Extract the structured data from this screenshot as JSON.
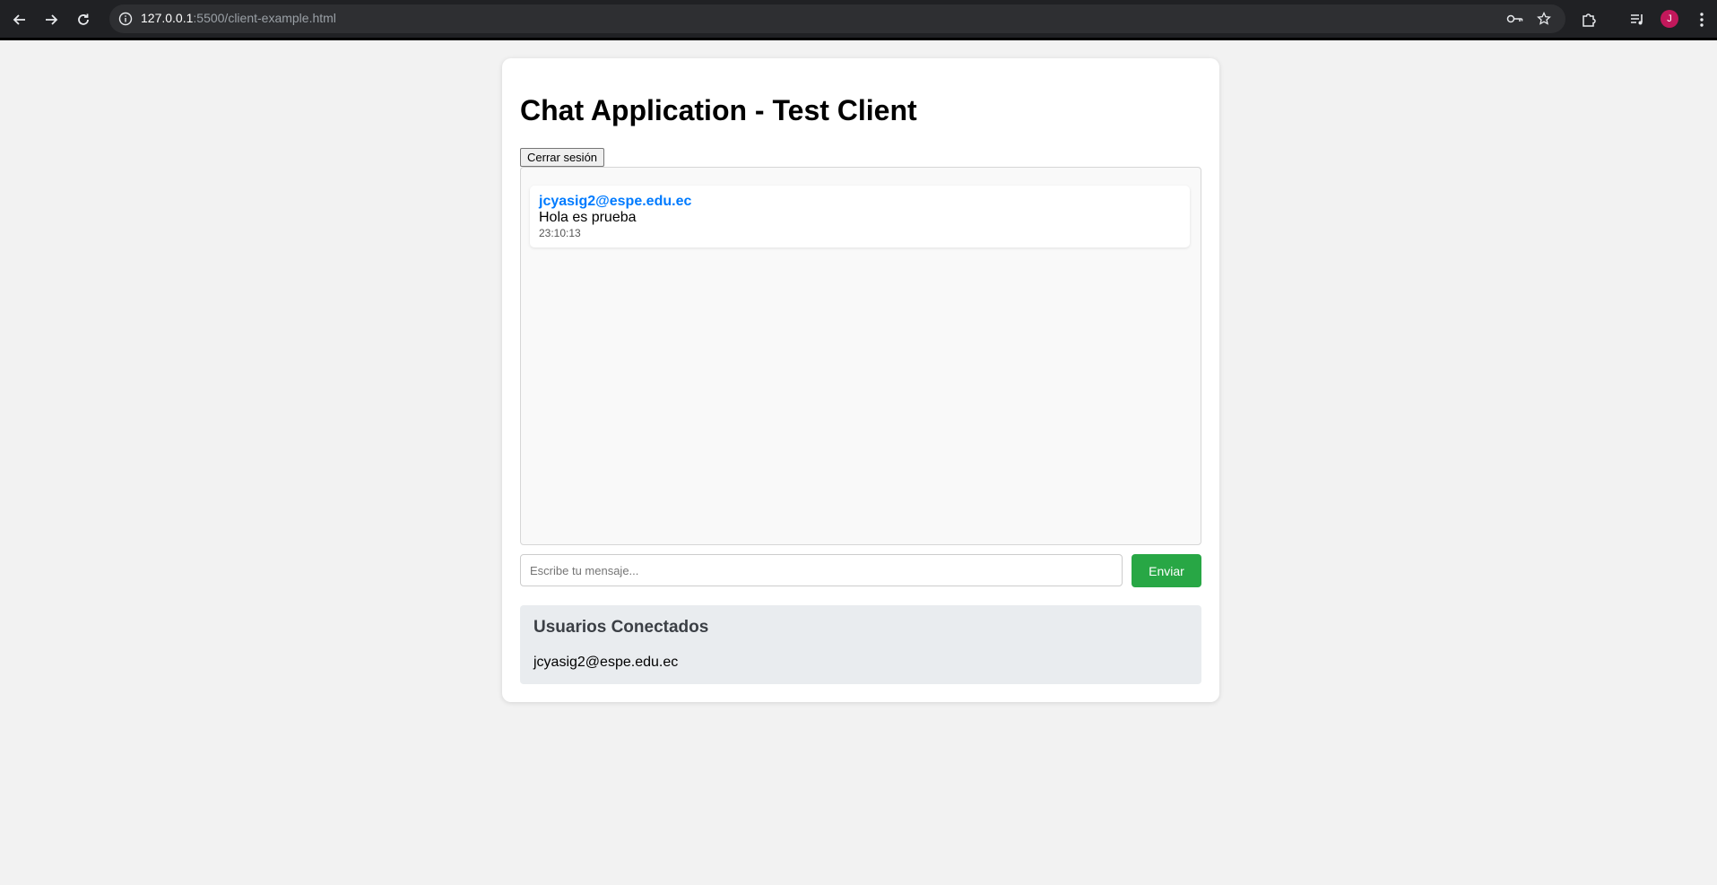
{
  "browser": {
    "url_host": "127.0.0.1",
    "url_path": ":5500/client-example.html",
    "profile_initial": "J",
    "icons": {
      "back": "back-arrow-icon",
      "forward": "forward-arrow-icon",
      "reload": "reload-icon",
      "site_info": "info-icon",
      "password": "key-icon",
      "bookmark": "star-icon",
      "extensions": "puzzle-icon",
      "media": "media-control-icon",
      "menu": "kebab-menu-icon"
    }
  },
  "page": {
    "title": "Chat Application - Test Client",
    "logout_label": "Cerrar sesión",
    "messages": [
      {
        "author": "jcyasig2@espe.edu.ec",
        "text": "Hola es prueba",
        "time": "23:10:13"
      }
    ],
    "input": {
      "placeholder": "Escribe tu mensaje...",
      "value": ""
    },
    "send_label": "Enviar",
    "users": {
      "title": "Usuarios Conectados",
      "list": [
        "jcyasig2@espe.edu.ec"
      ]
    }
  },
  "colors": {
    "author": "#007bff",
    "send_button": "#28a745",
    "users_panel": "#e9ecef",
    "avatar": "#c2185b"
  }
}
